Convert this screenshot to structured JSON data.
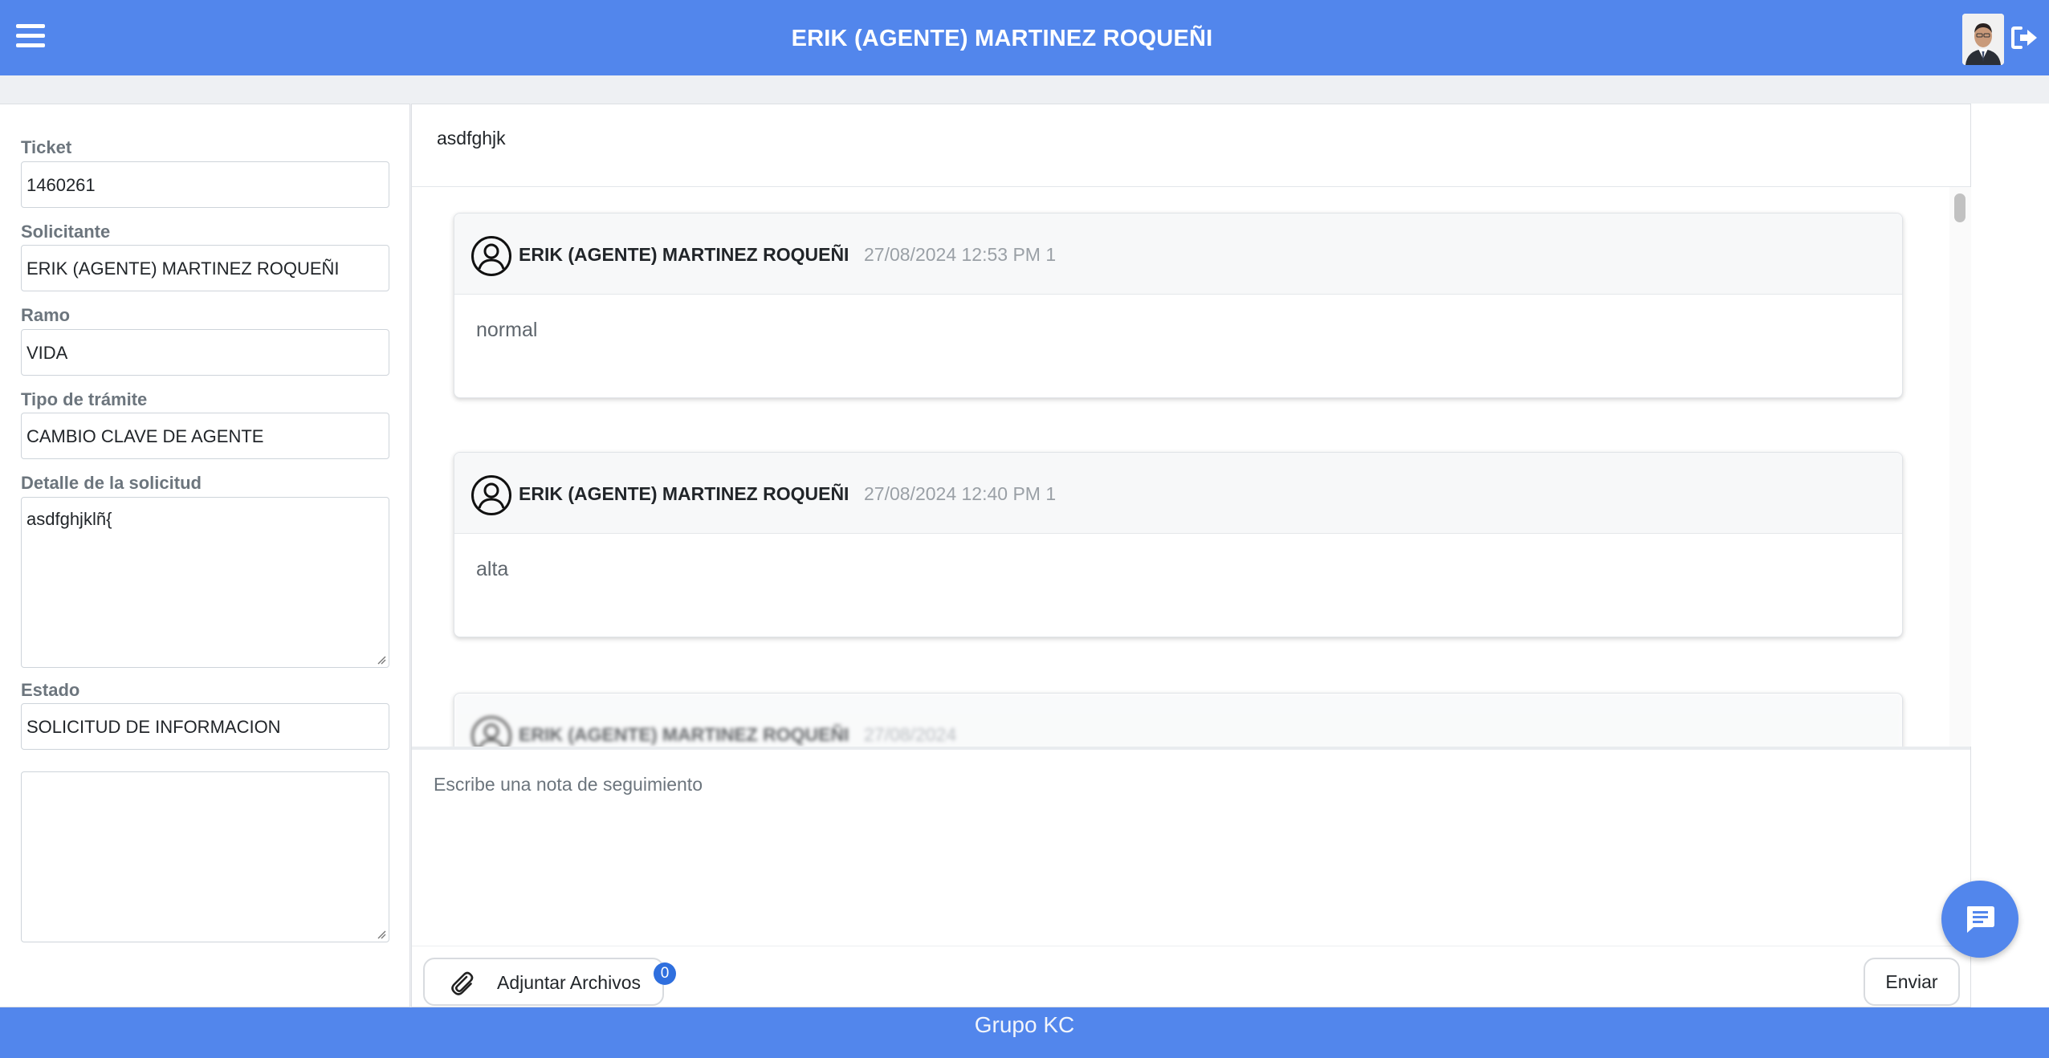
{
  "header": {
    "title": "ERIK (AGENTE) MARTINEZ ROQUEÑI",
    "menu_icon": "hamburger-menu-icon",
    "logout_icon": "logout-icon"
  },
  "form": {
    "ticket": {
      "label": "Ticket",
      "value": "1460261"
    },
    "solicitante": {
      "label": "Solicitante",
      "value": "ERIK (AGENTE) MARTINEZ ROQUEÑI"
    },
    "ramo": {
      "label": "Ramo",
      "value": "VIDA"
    },
    "tipo_tramite": {
      "label": "Tipo de trámite",
      "value": "CAMBIO CLAVE DE AGENTE"
    },
    "detalle": {
      "label": "Detalle de la solicitud",
      "value": "asdfghjklñ{"
    },
    "estado": {
      "label": "Estado",
      "value": "SOLICITUD DE INFORMACION"
    },
    "extra_notes": {
      "value": ""
    }
  },
  "conversation": {
    "subject": "asdfghjk",
    "messages": [
      {
        "author": "ERIK (AGENTE) MARTINEZ ROQUEÑI",
        "date": "27/08/2024 12:53 PM 1",
        "body": "normal"
      },
      {
        "author": "ERIK (AGENTE) MARTINEZ ROQUEÑI",
        "date": "27/08/2024 12:40 PM 1",
        "body": "alta"
      },
      {
        "author": "ERIK (AGENTE) MARTINEZ ROQUEÑI",
        "date": "27/08/2024",
        "body": ""
      }
    ],
    "note_placeholder": "Escribe una nota de seguimiento",
    "attach_label": "Adjuntar Archivos",
    "attach_count": "0",
    "send_label": "Enviar"
  },
  "footer": {
    "text": "Grupo KC"
  },
  "colors": {
    "brand": "#5286ec",
    "badge": "#2f6fde"
  }
}
